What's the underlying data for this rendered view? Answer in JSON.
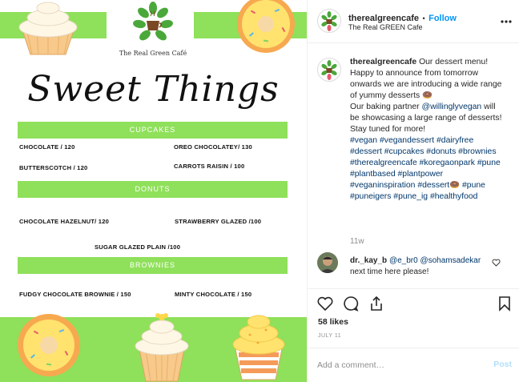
{
  "image": {
    "logo_name": "The Real Green Café",
    "title": "Sweet Things",
    "sections": [
      {
        "label": "CUPCAKES",
        "items": [
          "CHOCOLATE / 120",
          "OREO CHOCOLATEY/ 130",
          "BUTTERSCOTCH / 120",
          "CARROTS RAISIN / 100"
        ]
      },
      {
        "label": "DONUTS",
        "items": [
          "CHOCOLATE HAZELNUT/ 120",
          "STRAWBERRY GLAZED /100",
          "SUGAR GLAZED PLAIN /100"
        ]
      },
      {
        "label": "BROWNIES",
        "items": [
          "FUDGY CHOCOLATE  BROWNIE / 150",
          "MINTY CHOCOLATE / 150"
        ]
      }
    ]
  },
  "header": {
    "username": "therealgreencafe",
    "separator": "•",
    "follow_label": "Follow",
    "subtitle": "The Real GREEN Cafe"
  },
  "caption": {
    "username": "therealgreencafe",
    "text_1": "Our dessert menu! Happy to announce from tomorrow onwards we are introducing a wide range of yummy desserts 🍩",
    "text_2a": "Our baking partner ",
    "mention": "@willinglyvegan",
    "text_2b": " will be showcasing a large range of desserts!",
    "text_3": "Stay tuned for more!",
    "hashtags_a": "#vegan #vegandessert #dairyfree #dessert #cupcakes #donuts #brownies #therealgreencafe #koregaonpark #pune #plantbased #plantpower #veganinspiration #dessert🍩 #pune #puneigers #pune_ig #healthyfood",
    "time_ago": "11w"
  },
  "comment": {
    "username": "dr._kay_b",
    "mention_1": "@e_br0",
    "mention_2": "@sohamsadekar",
    "text": " next time here please!"
  },
  "icons": [
    "heart-icon",
    "comment-icon",
    "share-icon",
    "bookmark-icon",
    "more-icon"
  ],
  "likes": "58 likes",
  "date": "JULY 11",
  "add_comment": {
    "placeholder": "Add a comment…",
    "post_label": "Post"
  },
  "colors": {
    "accent_green": "#8fe05a",
    "link_blue": "#0095f6",
    "hashtag": "#00376b",
    "muted": "#8e8e8e"
  }
}
